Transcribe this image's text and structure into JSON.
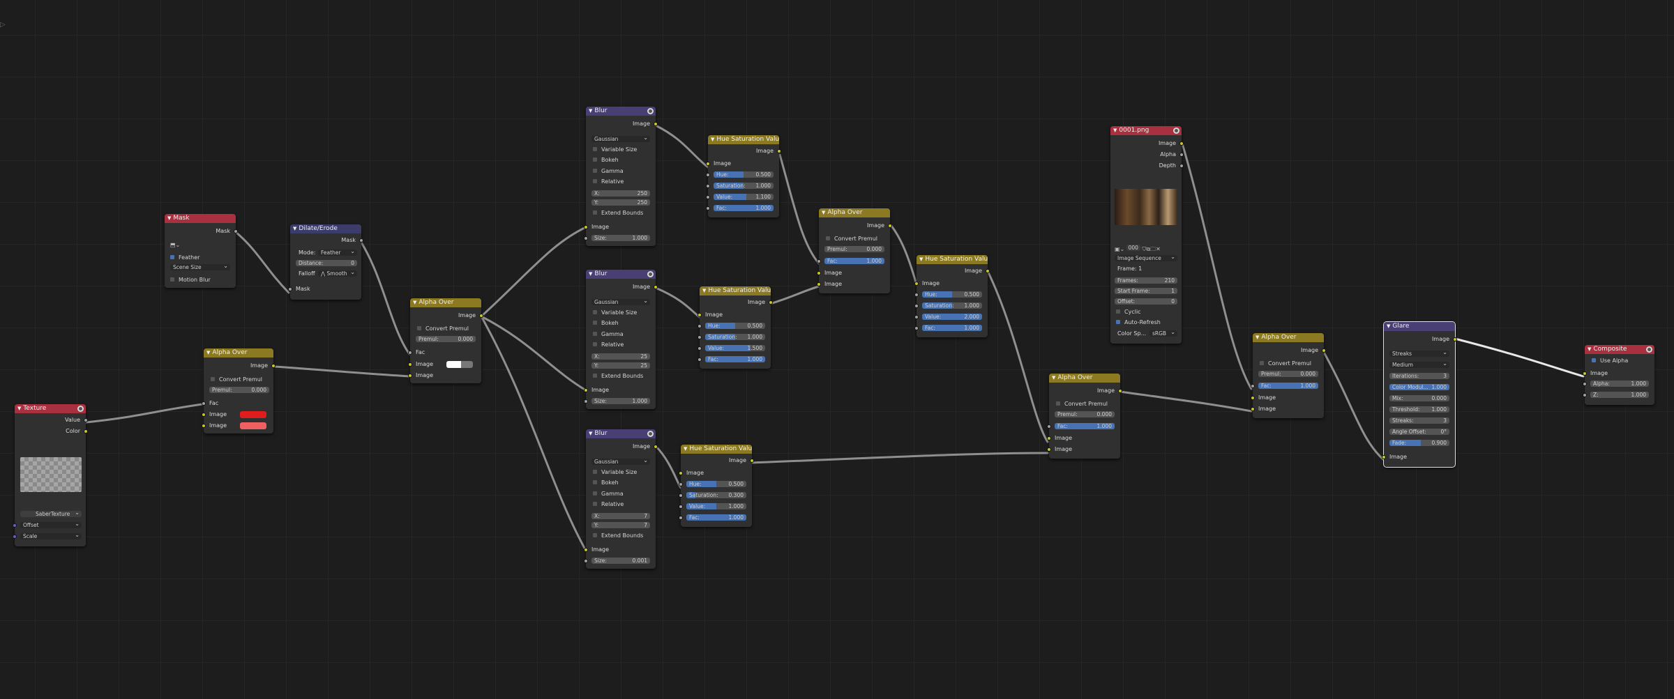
{
  "nodes": {
    "texture": {
      "title": "Texture",
      "outputs": [
        "Value",
        "Color"
      ],
      "texture_name": "SaberTexture",
      "inputs": [
        "Offset",
        "Scale"
      ]
    },
    "mask": {
      "title": "Mask",
      "output": "Mask",
      "feather_label": "Feather",
      "size_mode": "Scene Size",
      "motion_blur_label": "Motion Blur"
    },
    "dilate": {
      "title": "Dilate/Erode",
      "output": "Mask",
      "mode_label": "Mode:",
      "mode_value": "Feather",
      "distance_label": "Distance:",
      "distance_value": "0",
      "falloff_label": "Falloff",
      "falloff_value": "Smooth",
      "input": "Mask"
    },
    "alpha_over_1": {
      "title": "Alpha Over",
      "output": "Image",
      "convert_premul": "Convert Premul",
      "premul_label": "Premul:",
      "premul_value": "0.000",
      "fac": "Fac",
      "image1": "Image",
      "image2": "Image",
      "color1": "#e01c1c",
      "color2": "#f06060"
    },
    "alpha_over_2": {
      "title": "Alpha Over",
      "output": "Image",
      "convert_premul": "Convert Premul",
      "premul_label": "Premul:",
      "premul_value": "0.000",
      "fac": "Fac",
      "image1": "Image",
      "image2": "Image"
    },
    "blur_1": {
      "title": "Blur",
      "output": "Image",
      "filter": "Gaussian",
      "variable_size": "Variable Size",
      "bokeh": "Bokeh",
      "gamma": "Gamma",
      "relative": "Relative",
      "x_label": "X:",
      "x_value": "250",
      "y_label": "Y:",
      "y_value": "250",
      "extend_bounds": "Extend Bounds",
      "input": "Image",
      "size_label": "Size:",
      "size_value": "1.000"
    },
    "blur_2": {
      "title": "Blur",
      "output": "Image",
      "filter": "Gaussian",
      "variable_size": "Variable Size",
      "bokeh": "Bokeh",
      "gamma": "Gamma",
      "relative": "Relative",
      "x_label": "X:",
      "x_value": "25",
      "y_label": "Y:",
      "y_value": "25",
      "extend_bounds": "Extend Bounds",
      "input": "Image",
      "size_label": "Size:",
      "size_value": "1.000"
    },
    "blur_3": {
      "title": "Blur",
      "output": "Image",
      "filter": "Gaussian",
      "variable_size": "Variable Size",
      "bokeh": "Bokeh",
      "gamma": "Gamma",
      "relative": "Relative",
      "x_label": "X:",
      "x_value": "7",
      "y_label": "Y:",
      "y_value": "7",
      "extend_bounds": "Extend Bounds",
      "input": "Image",
      "size_label": "Size:",
      "size_value": "0.001"
    },
    "hsv_1": {
      "title": "Hue Saturation Value",
      "output": "Image",
      "input": "Image",
      "hue_label": "Hue:",
      "hue_value": "0.500",
      "sat_label": "Saturation:",
      "sat_value": "1.000",
      "val_label": "Value:",
      "val_value": "1.100",
      "fac_label": "Fac:",
      "fac_value": "1.000"
    },
    "hsv_2": {
      "title": "Hue Saturation Value",
      "output": "Image",
      "input": "Image",
      "hue_label": "Hue:",
      "hue_value": "0.500",
      "sat_label": "Saturation:",
      "sat_value": "1.000",
      "val_label": "Value:",
      "val_value": "1.500",
      "fac_label": "Fac:",
      "fac_value": "1.000"
    },
    "hsv_3": {
      "title": "Hue Saturation Value",
      "output": "Image",
      "input": "Image",
      "hue_label": "Hue:",
      "hue_value": "0.500",
      "sat_label": "Saturation:",
      "sat_value": "0.300",
      "val_label": "Value:",
      "val_value": "1.000",
      "fac_label": "Fac:",
      "fac_value": "1.000"
    },
    "hsv_4": {
      "title": "Hue Saturation Value",
      "output": "Image",
      "input": "Image",
      "hue_label": "Hue:",
      "hue_value": "0.500",
      "sat_label": "Saturation:",
      "sat_value": "1.000",
      "val_label": "Value:",
      "val_value": "2.000",
      "fac_label": "Fac:",
      "fac_value": "1.000"
    },
    "alpha_over_3": {
      "title": "Alpha Over",
      "output": "Image",
      "convert_premul": "Convert Premul",
      "premul_label": "Premul:",
      "premul_value": "0.000",
      "fac_label": "Fac:",
      "fac_value": "1.000",
      "image1": "Image",
      "image2": "Image"
    },
    "alpha_over_4": {
      "title": "Alpha Over",
      "output": "Image",
      "convert_premul": "Convert Premul",
      "premul_label": "Premul:",
      "premul_value": "0.000",
      "fac_label": "Fac:",
      "fac_value": "1.000",
      "image1": "Image",
      "image2": "Image"
    },
    "alpha_over_5": {
      "title": "Alpha Over",
      "output": "Image",
      "convert_premul": "Convert Premul",
      "premul_label": "Premul:",
      "premul_value": "0.000",
      "fac_label": "Fac:",
      "fac_value": "1.000",
      "image1": "Image",
      "image2": "Image"
    },
    "image": {
      "title": "0001.png",
      "outputs": [
        "Image",
        "Alpha",
        "Depth"
      ],
      "frame_field": "000",
      "source": "Image Sequence",
      "frame_info": "Frame: 1",
      "frames_label": "Frames:",
      "frames_value": "210",
      "start_label": "Start Frame:",
      "start_value": "1",
      "offset_label": "Offset:",
      "offset_value": "0",
      "cyclic": "Cyclic",
      "auto_refresh": "Auto-Refresh",
      "colorspace_label": "Color Sp...",
      "colorspace_value": "sRGB"
    },
    "glare": {
      "title": "Glare",
      "output": "Image",
      "type": "Streaks",
      "quality": "Medium",
      "iterations_label": "Iterations:",
      "iterations_value": "3",
      "color_mod_label": "Color Modul...",
      "color_mod_value": "1.000",
      "mix_label": "Mix:",
      "mix_value": "0.000",
      "threshold_label": "Threshold:",
      "threshold_value": "1.000",
      "streaks_label": "Streaks:",
      "streaks_value": "3",
      "angle_label": "Angle Offset:",
      "angle_value": "0°",
      "fade_label": "Fade:",
      "fade_value": "0.900",
      "input": "Image"
    },
    "composite": {
      "title": "Composite",
      "use_alpha": "Use Alpha",
      "image": "Image",
      "alpha_label": "Alpha:",
      "alpha_value": "1.000",
      "z_label": "Z:",
      "z_value": "1.000"
    }
  },
  "colors": {
    "background": "#1d1d1d",
    "wire": "#9a9a9a",
    "field_accent": "#4772b3",
    "socket_color": "#c7c729",
    "socket_value": "#a1a1a1",
    "socket_vector": "#6363c7"
  }
}
